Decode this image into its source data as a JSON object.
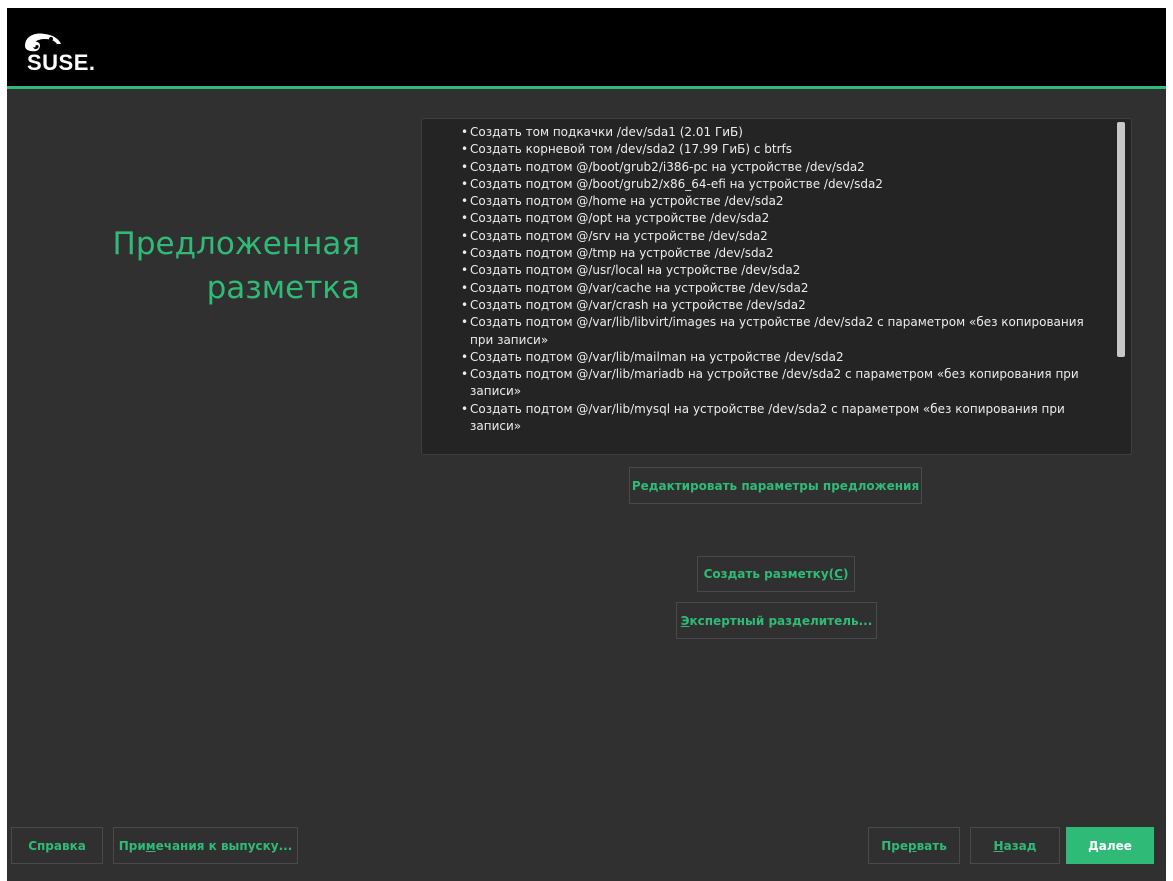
{
  "branding": {
    "logo_text": "SUSE."
  },
  "colors": {
    "accent": "#30ba78",
    "background": "#303030",
    "header": "#000000"
  },
  "title": {
    "line1": "Предложенная",
    "line2": "разметка"
  },
  "actions": [
    "Создать том подкачки /dev/sda1 (2.01 ГиБ)",
    "Создать корневой том /dev/sda2 (17.99 ГиБ) с btrfs",
    "Создать подтом @/boot/grub2/i386-pc на устройстве /dev/sda2",
    "Создать подтом @/boot/grub2/x86_64-efi на устройстве /dev/sda2",
    "Создать подтом @/home на устройстве /dev/sda2",
    "Создать подтом @/opt на устройстве /dev/sda2",
    "Создать подтом @/srv на устройстве /dev/sda2",
    "Создать подтом @/tmp на устройстве /dev/sda2",
    "Создать подтом @/usr/local на устройстве /dev/sda2",
    "Создать подтом @/var/cache на устройстве /dev/sda2",
    "Создать подтом @/var/crash на устройстве /dev/sda2",
    "Создать подтом @/var/lib/libvirt/images на устройстве /dev/sda2 с параметром «без копирования при записи»",
    "Создать подтом @/var/lib/mailman на устройстве /dev/sda2",
    "Создать подтом @/var/lib/mariadb на устройстве /dev/sda2 с параметром «без копирования при записи»",
    "Создать подтом @/var/lib/mysql на устройстве /dev/sda2 с параметром «без копирования при записи»"
  ],
  "buttons": {
    "edit_proposal": "Редактировать параметры предложения",
    "create_partitioning": {
      "before": "Создать разметку(",
      "mnemonic": "С",
      "after": ")"
    },
    "expert_partitioner": {
      "before": "",
      "mnemonic": "Э",
      "after": "кспертный разделитель..."
    },
    "help": "Справка",
    "release_notes": {
      "before": "При",
      "mnemonic": "м",
      "after": "ечания к выпуску..."
    },
    "abort": {
      "before": "Пре",
      "mnemonic": "р",
      "after": "вать"
    },
    "back": {
      "before": "",
      "mnemonic": "Н",
      "after": "азад"
    },
    "next": {
      "before": "",
      "mnemonic": "Д",
      "after": "алее"
    }
  }
}
